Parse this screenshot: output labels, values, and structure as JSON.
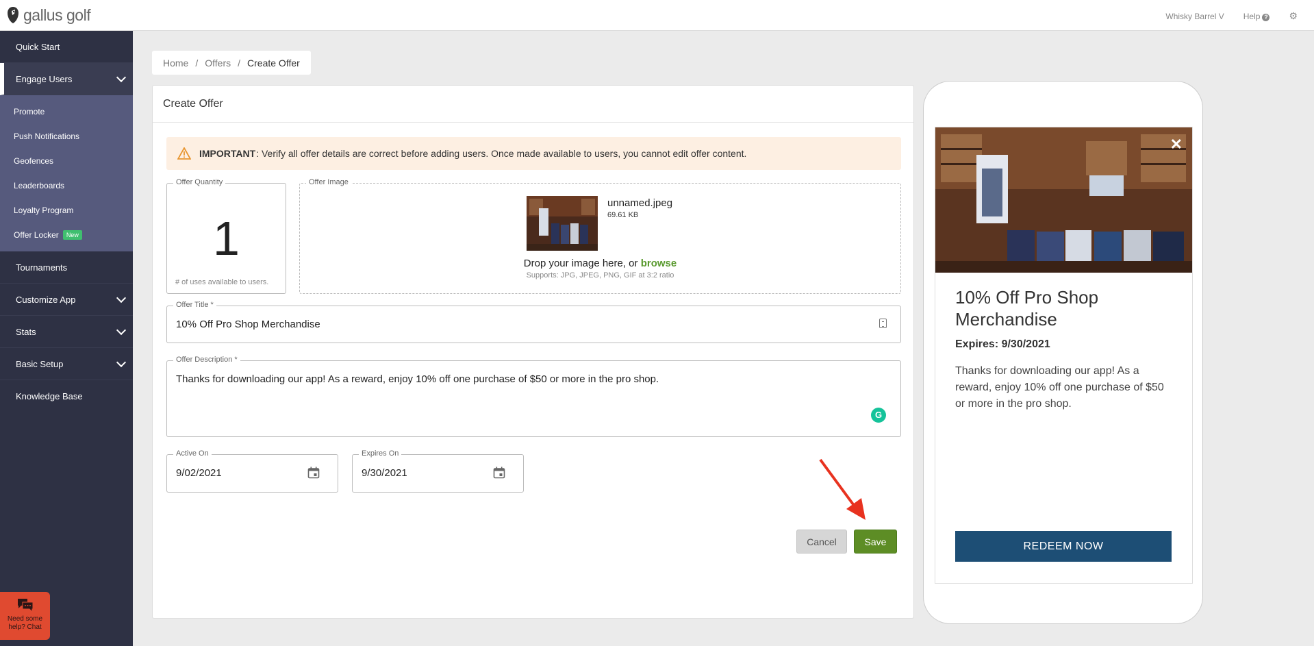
{
  "header": {
    "logo_text_1": "gallus",
    "logo_text_2": "golf",
    "account_name": "Whisky Barrel V",
    "help_label": "Help"
  },
  "sidebar": {
    "quick_start": "Quick Start",
    "engage_users": "Engage Users",
    "sub_items": [
      "Promote",
      "Push Notifications",
      "Geofences",
      "Leaderboards",
      "Loyalty Program",
      "Offer Locker"
    ],
    "new_badge": "New",
    "tournaments": "Tournaments",
    "customize_app": "Customize App",
    "stats": "Stats",
    "basic_setup": "Basic Setup",
    "knowledge_base": "Knowledge Base",
    "chat_label": "Need some help? Chat"
  },
  "breadcrumb": [
    "Home",
    "Offers",
    "Create Offer"
  ],
  "form": {
    "title": "Create Offer",
    "alert_strong": "IMPORTANT",
    "alert_text": ": Verify all offer details are correct before adding users. Once made available to users, you cannot edit offer content.",
    "quantity_label": "Offer Quantity",
    "quantity_value": "1",
    "quantity_help": "# of uses available to users.",
    "image_label": "Offer Image",
    "image_filename": "unnamed.jpeg",
    "image_size": "69.61 KB",
    "drop_text": "Drop your image here, or",
    "browse_text": "browse",
    "supports_text": "Supports: JPG, JPEG, PNG, GIF at 3:2 ratio",
    "title_label": "Offer Title *",
    "title_value": "10% Off Pro Shop Merchandise",
    "desc_label": "Offer Description *",
    "desc_value": "Thanks for downloading our app! As a reward, enjoy 10% off one purchase of $50 or more in the pro shop.",
    "active_label": "Active On",
    "active_value": "9/02/2021",
    "expires_label": "Expires On",
    "expires_value": "9/30/2021",
    "cancel_label": "Cancel",
    "save_label": "Save"
  },
  "preview": {
    "title": "10% Off Pro Shop Merchandise",
    "expires": "Expires: 9/30/2021",
    "description": "Thanks for downloading our app! As a reward, enjoy 10% off one purchase of $50 or more in the pro shop.",
    "redeem_label": "REDEEM NOW"
  },
  "colors": {
    "brand_green": "#5d8d25",
    "sidebar_bg": "#2e3144",
    "subnav_bg": "#565a7d",
    "redeem_blue": "#1d4e75",
    "alert_bg": "#fdefe2",
    "annotation_arrow": "#e8321f"
  }
}
